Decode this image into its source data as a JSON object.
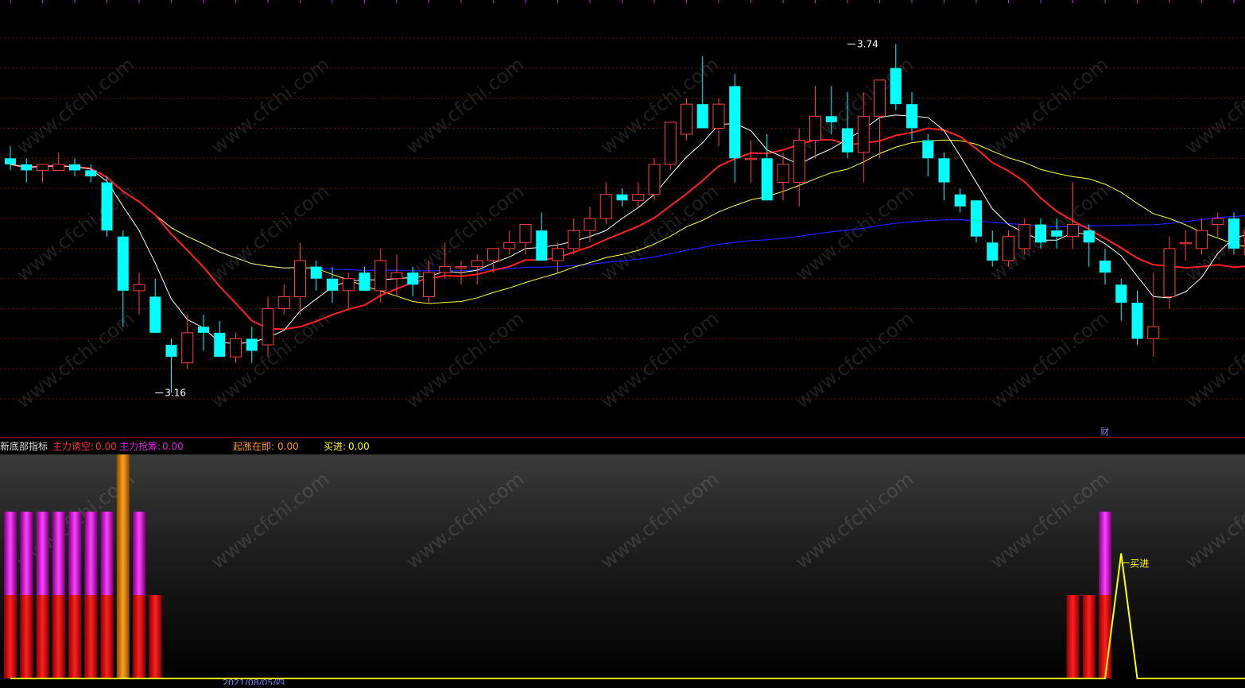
{
  "chart_data": [
    {
      "type": "candlestick",
      "panel": "main",
      "ylim": [
        3.1,
        3.8
      ],
      "annotations": [
        {
          "text": "3.74",
          "value": 3.74,
          "bar_index": 52
        },
        {
          "text": "3.16",
          "value": 3.16,
          "bar_index": 9
        }
      ],
      "event_markers": [
        {
          "text": "财",
          "bar_index": 68
        }
      ],
      "colors": {
        "up": "#ff4040",
        "down": "#00ffff",
        "ma_short": "#ffffff",
        "ma_mid": "#ff2020",
        "ma_long": "#ffff40",
        "ma_longest": "#2020ff"
      },
      "ohlc": [
        [
          3.55,
          3.57,
          3.53,
          3.54
        ],
        [
          3.54,
          3.55,
          3.51,
          3.53
        ],
        [
          3.53,
          3.54,
          3.51,
          3.54
        ],
        [
          3.53,
          3.56,
          3.53,
          3.54
        ],
        [
          3.54,
          3.55,
          3.52,
          3.53
        ],
        [
          3.53,
          3.54,
          3.51,
          3.52
        ],
        [
          3.51,
          3.52,
          3.42,
          3.43
        ],
        [
          3.42,
          3.43,
          3.27,
          3.33
        ],
        [
          3.33,
          3.36,
          3.29,
          3.34
        ],
        [
          3.32,
          3.35,
          3.26,
          3.26
        ],
        [
          3.24,
          3.25,
          3.16,
          3.22
        ],
        [
          3.21,
          3.29,
          3.2,
          3.26
        ],
        [
          3.27,
          3.29,
          3.23,
          3.26
        ],
        [
          3.26,
          3.28,
          3.22,
          3.22
        ],
        [
          3.22,
          3.26,
          3.21,
          3.25
        ],
        [
          3.25,
          3.27,
          3.21,
          3.23
        ],
        [
          3.24,
          3.32,
          3.22,
          3.3
        ],
        [
          3.3,
          3.34,
          3.29,
          3.32
        ],
        [
          3.32,
          3.41,
          3.29,
          3.38
        ],
        [
          3.37,
          3.38,
          3.33,
          3.35
        ],
        [
          3.35,
          3.37,
          3.31,
          3.33
        ],
        [
          3.33,
          3.36,
          3.3,
          3.35
        ],
        [
          3.36,
          3.37,
          3.33,
          3.33
        ],
        [
          3.33,
          3.4,
          3.31,
          3.38
        ],
        [
          3.35,
          3.39,
          3.32,
          3.36
        ],
        [
          3.36,
          3.37,
          3.32,
          3.34
        ],
        [
          3.32,
          3.38,
          3.31,
          3.36
        ],
        [
          3.36,
          3.41,
          3.35,
          3.37
        ],
        [
          3.37,
          3.38,
          3.34,
          3.37
        ],
        [
          3.37,
          3.39,
          3.34,
          3.38
        ],
        [
          3.38,
          3.4,
          3.36,
          3.4
        ],
        [
          3.4,
          3.43,
          3.39,
          3.41
        ],
        [
          3.41,
          3.44,
          3.39,
          3.44
        ],
        [
          3.43,
          3.46,
          3.4,
          3.38
        ],
        [
          3.38,
          3.41,
          3.36,
          3.4
        ],
        [
          3.4,
          3.45,
          3.39,
          3.43
        ],
        [
          3.43,
          3.47,
          3.41,
          3.45
        ],
        [
          3.45,
          3.51,
          3.44,
          3.49
        ],
        [
          3.49,
          3.5,
          3.47,
          3.48
        ],
        [
          3.48,
          3.51,
          3.47,
          3.49
        ],
        [
          3.49,
          3.55,
          3.48,
          3.54
        ],
        [
          3.54,
          3.58,
          3.53,
          3.61
        ],
        [
          3.59,
          3.65,
          3.58,
          3.64
        ],
        [
          3.64,
          3.72,
          3.63,
          3.6
        ],
        [
          3.6,
          3.65,
          3.57,
          3.64
        ],
        [
          3.67,
          3.69,
          3.51,
          3.55
        ],
        [
          3.55,
          3.58,
          3.51,
          3.55
        ],
        [
          3.55,
          3.59,
          3.48,
          3.48
        ],
        [
          3.51,
          3.56,
          3.48,
          3.54
        ],
        [
          3.51,
          3.6,
          3.47,
          3.58
        ],
        [
          3.58,
          3.67,
          3.55,
          3.62
        ],
        [
          3.62,
          3.67,
          3.59,
          3.61
        ],
        [
          3.6,
          3.66,
          3.55,
          3.56
        ],
        [
          3.56,
          3.66,
          3.51,
          3.62
        ],
        [
          3.62,
          3.68,
          3.55,
          3.68
        ],
        [
          3.7,
          3.74,
          3.63,
          3.64
        ],
        [
          3.64,
          3.66,
          3.58,
          3.6
        ],
        [
          3.58,
          3.59,
          3.52,
          3.55
        ],
        [
          3.55,
          3.56,
          3.48,
          3.51
        ],
        [
          3.49,
          3.5,
          3.46,
          3.47
        ],
        [
          3.48,
          3.48,
          3.41,
          3.42
        ],
        [
          3.41,
          3.43,
          3.37,
          3.38
        ],
        [
          3.38,
          3.43,
          3.37,
          3.42
        ],
        [
          3.4,
          3.45,
          3.39,
          3.44
        ],
        [
          3.44,
          3.45,
          3.4,
          3.41
        ],
        [
          3.43,
          3.45,
          3.4,
          3.42
        ],
        [
          3.42,
          3.51,
          3.4,
          3.44
        ],
        [
          3.43,
          3.44,
          3.37,
          3.41
        ],
        [
          3.38,
          3.4,
          3.34,
          3.36
        ],
        [
          3.34,
          3.35,
          3.28,
          3.31
        ],
        [
          3.31,
          3.33,
          3.24,
          3.25
        ],
        [
          3.25,
          3.36,
          3.22,
          3.27
        ],
        [
          3.32,
          3.42,
          3.3,
          3.4
        ],
        [
          3.41,
          3.43,
          3.38,
          3.41
        ],
        [
          3.4,
          3.45,
          3.39,
          3.43
        ],
        [
          3.44,
          3.46,
          3.42,
          3.45
        ],
        [
          3.45,
          3.46,
          3.39,
          3.4
        ],
        [
          3.39,
          3.44,
          3.38,
          3.43
        ],
        [
          3.42,
          3.45,
          3.39,
          3.4
        ],
        [
          3.4,
          3.42,
          3.39,
          3.41
        ]
      ]
    },
    {
      "type": "bar",
      "panel": "indicator",
      "title": "新底部指标",
      "legend": [
        {
          "label": "主力诱空:",
          "value": "0.00",
          "color": "#ff3030"
        },
        {
          "label": "主力抢筹:",
          "value": "0.00",
          "color": "#e020e0"
        },
        {
          "label": "起涨在即:",
          "value": "0.00",
          "color": "#ff9900"
        },
        {
          "label": "买进:",
          "value": "0.00",
          "color": "#ffff00"
        }
      ],
      "ylim": [
        0,
        100
      ],
      "series": [
        {
          "name": "主力诱空",
          "color": "#ff1a1a",
          "values": [
            50,
            50,
            50,
            50,
            50,
            50,
            50,
            0,
            50,
            50,
            0,
            0,
            0,
            0,
            0,
            0,
            0,
            0,
            0,
            0,
            0,
            0,
            0,
            0,
            0,
            0,
            0,
            0,
            0,
            0,
            0,
            0,
            0,
            0,
            0,
            0,
            0,
            0,
            0,
            0,
            0,
            0,
            0,
            0,
            0,
            0,
            0,
            0,
            0,
            0,
            0,
            0,
            0,
            0,
            0,
            0,
            0,
            0,
            0,
            0,
            0,
            0,
            0,
            0,
            0,
            0,
            50,
            50,
            50,
            0,
            0,
            0,
            0,
            0,
            0,
            0,
            0,
            0,
            0,
            0
          ]
        },
        {
          "name": "主力抢筹",
          "color": "#e020e0",
          "values": [
            100,
            100,
            100,
            100,
            100,
            100,
            100,
            0,
            100,
            0,
            0,
            0,
            0,
            0,
            0,
            0,
            0,
            0,
            0,
            0,
            0,
            0,
            0,
            0,
            0,
            0,
            0,
            0,
            0,
            0,
            0,
            0,
            0,
            0,
            0,
            0,
            0,
            0,
            0,
            0,
            0,
            0,
            0,
            0,
            0,
            0,
            0,
            0,
            0,
            0,
            0,
            0,
            0,
            0,
            0,
            0,
            0,
            0,
            0,
            0,
            0,
            0,
            0,
            0,
            0,
            0,
            0,
            0,
            100,
            0,
            0,
            0,
            0,
            0,
            0,
            0,
            0,
            0,
            0,
            0
          ]
        },
        {
          "name": "起涨在即",
          "color": "#ff9900",
          "values": [
            0,
            0,
            0,
            0,
            0,
            0,
            0,
            135,
            0,
            0,
            0,
            0,
            0,
            0,
            0,
            0,
            0,
            0,
            0,
            0,
            0,
            0,
            0,
            0,
            0,
            0,
            0,
            0,
            0,
            0,
            0,
            0,
            0,
            0,
            0,
            0,
            0,
            0,
            0,
            0,
            0,
            0,
            0,
            0,
            0,
            0,
            0,
            0,
            0,
            0,
            0,
            0,
            0,
            0,
            0,
            0,
            0,
            0,
            0,
            0,
            0,
            0,
            0,
            0,
            0,
            0,
            0,
            0,
            0,
            0,
            0,
            0,
            0,
            0,
            0,
            0,
            0,
            0,
            0,
            0
          ]
        },
        {
          "name": "买进",
          "color": "#ffff00",
          "values": [
            0,
            0,
            0,
            0,
            0,
            0,
            0,
            0,
            0,
            0,
            0,
            0,
            0,
            0,
            0,
            0,
            0,
            0,
            0,
            0,
            0,
            0,
            0,
            0,
            0,
            0,
            0,
            0,
            0,
            0,
            0,
            0,
            0,
            0,
            0,
            0,
            0,
            0,
            0,
            0,
            0,
            0,
            0,
            0,
            0,
            0,
            0,
            0,
            0,
            0,
            0,
            0,
            0,
            0,
            0,
            0,
            0,
            0,
            0,
            0,
            0,
            0,
            0,
            0,
            0,
            0,
            0,
            0,
            0,
            75,
            0,
            0,
            0,
            0,
            0,
            0,
            0,
            0,
            0,
            0
          ]
        }
      ],
      "annotations": [
        {
          "text": "买进",
          "bar_index": 69
        }
      ]
    }
  ],
  "watermark": "www.cfchi.com",
  "date_label": "2021/08/05/四"
}
